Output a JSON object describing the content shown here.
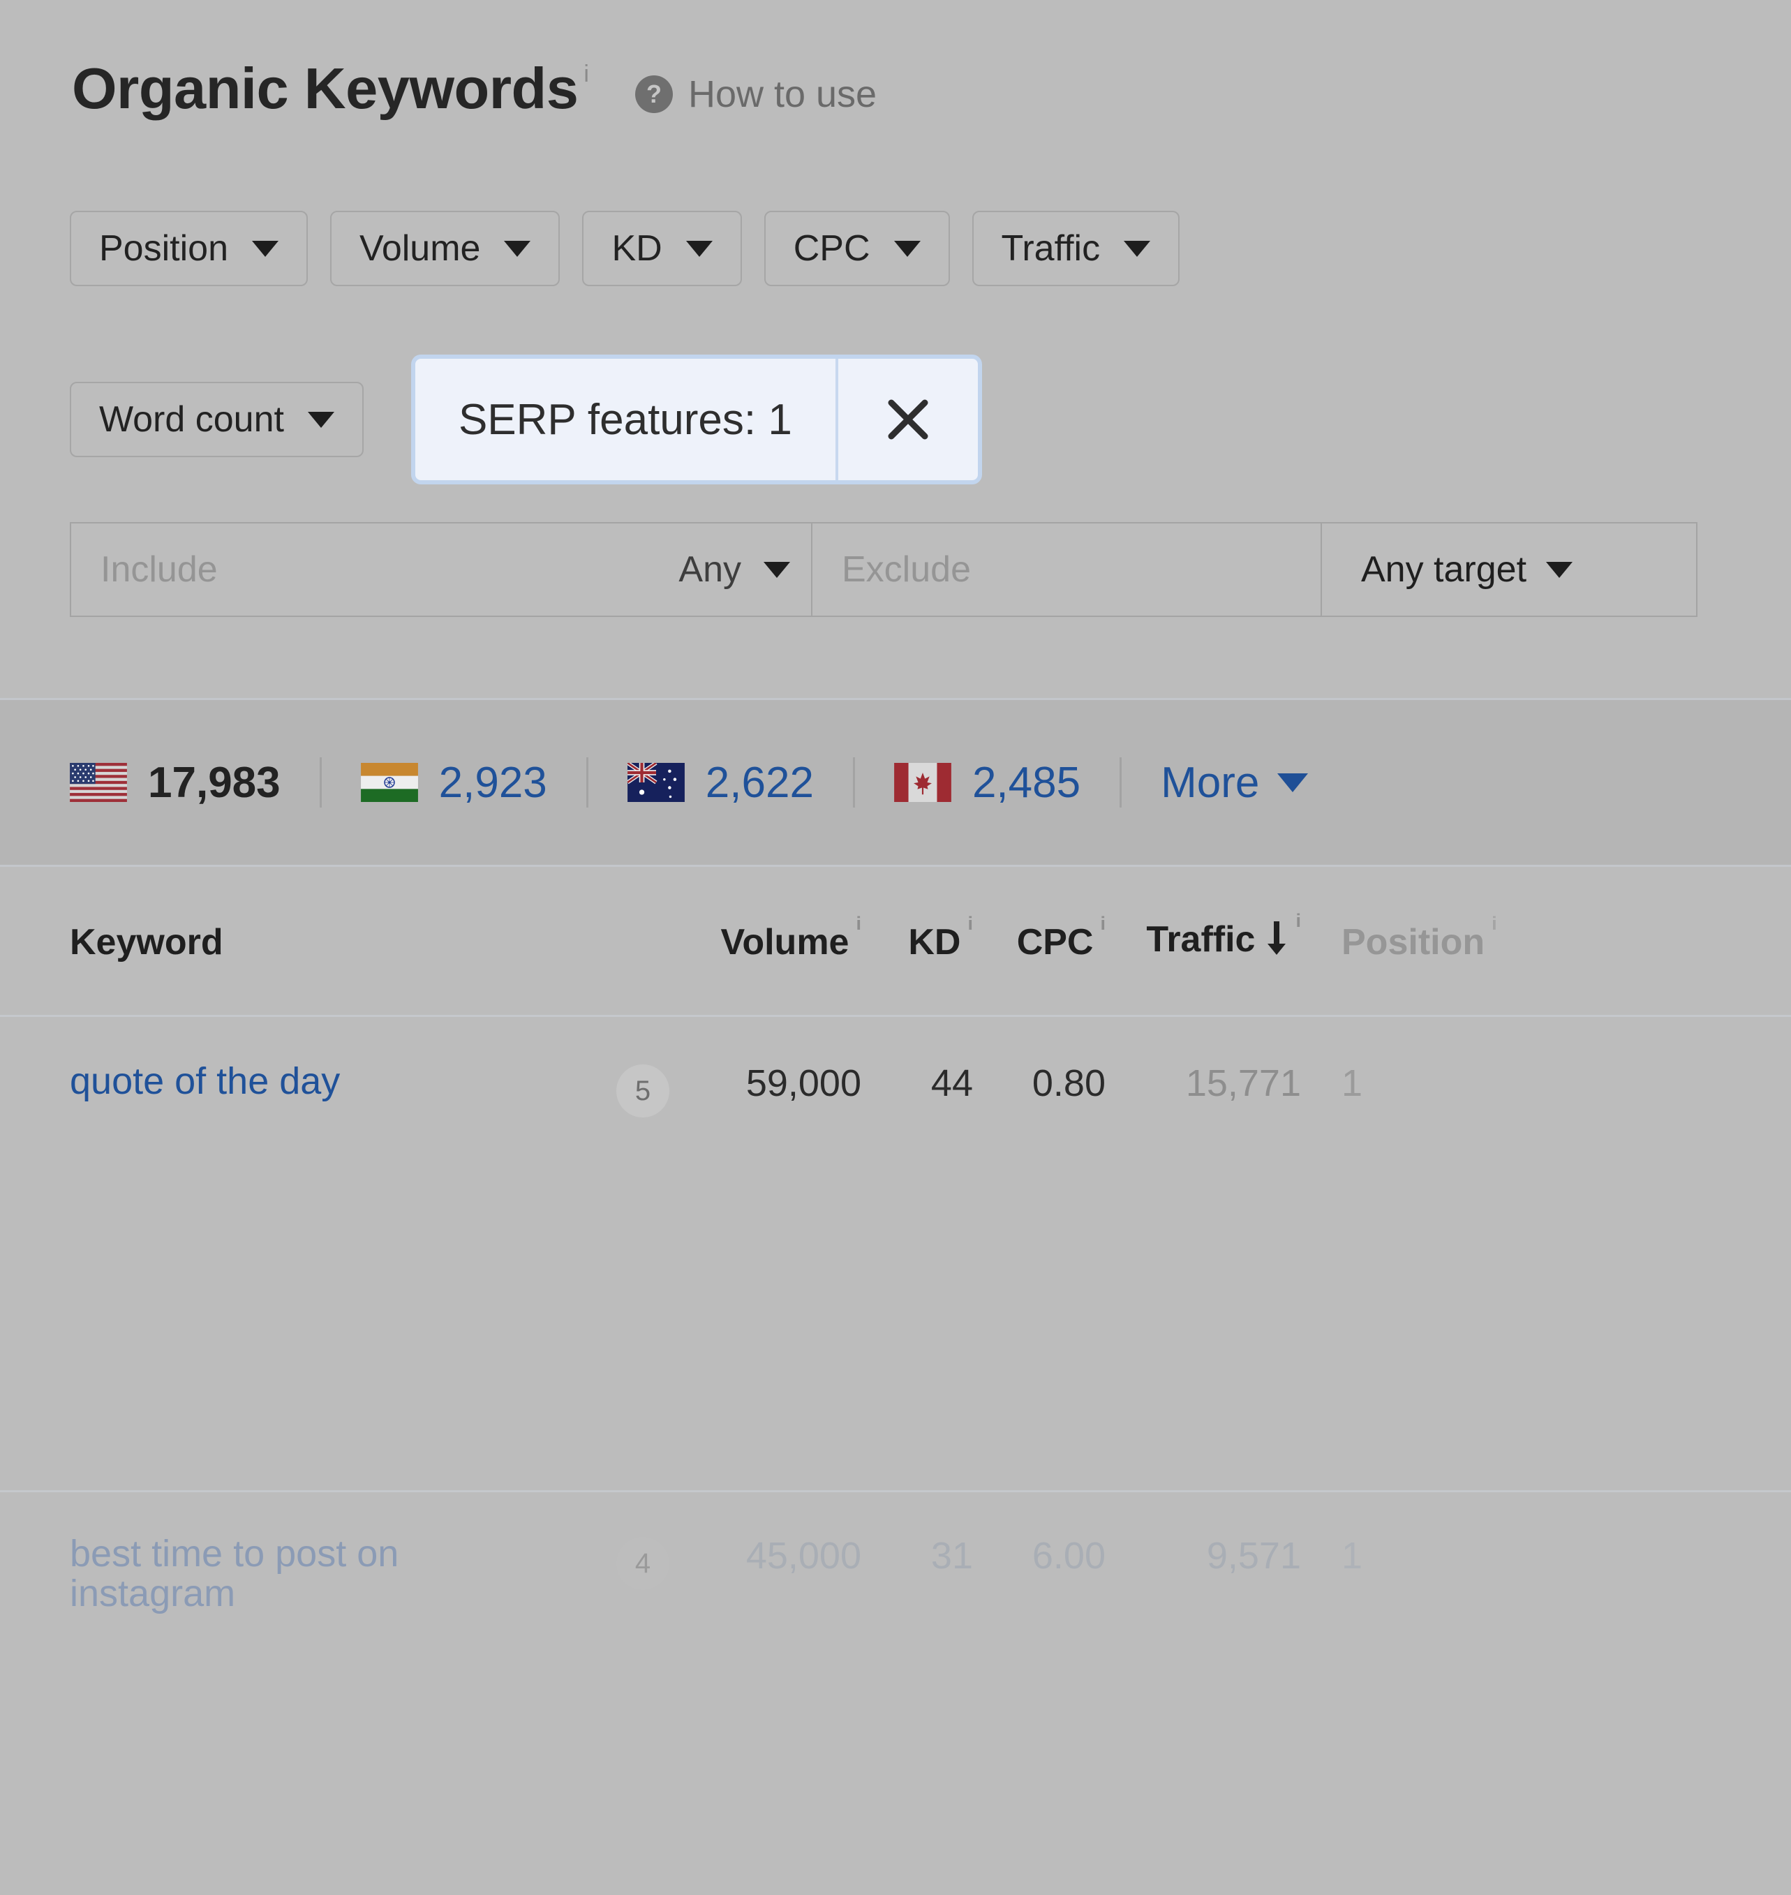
{
  "header": {
    "title": "Organic Keywords",
    "title_info_icon": "info-icon",
    "how_to_use": "How to use",
    "help_icon": "?"
  },
  "filters": {
    "row1": [
      {
        "label": "Position",
        "icon": "chevron-down-icon"
      },
      {
        "label": "Volume",
        "icon": "chevron-down-icon"
      },
      {
        "label": "KD",
        "icon": "chevron-down-icon"
      },
      {
        "label": "CPC",
        "icon": "chevron-down-icon"
      },
      {
        "label": "Traffic",
        "icon": "chevron-down-icon"
      }
    ],
    "row2": [
      {
        "label": "Word count",
        "icon": "chevron-down-icon"
      }
    ],
    "active_chip": {
      "label": "SERP features: 1",
      "close_icon": "close-icon",
      "fill": "#eef2fa",
      "border": "#c2d5ee"
    },
    "include_placeholder": "Include",
    "include_mode": "Any",
    "exclude_placeholder": "Exclude",
    "target_label": "Any target"
  },
  "countries": {
    "items": [
      {
        "flag": "us-flag",
        "count": "17,983",
        "active": true
      },
      {
        "flag": "in-flag",
        "count": "2,923",
        "active": false
      },
      {
        "flag": "au-flag",
        "count": "2,622",
        "active": false
      },
      {
        "flag": "ca-flag",
        "count": "2,485",
        "active": false
      }
    ],
    "more_label": "More",
    "more_icon": "chevron-down-icon"
  },
  "table": {
    "columns": {
      "keyword": "Keyword",
      "volume": "Volume",
      "kd": "KD",
      "cpc": "CPC",
      "traffic": "Traffic",
      "position": "Position"
    },
    "sort": {
      "column": "Traffic",
      "direction": "desc",
      "icon": "arrow-down-icon"
    },
    "rows": [
      {
        "keyword": "quote of the day",
        "badge": "5",
        "volume": "59,000",
        "kd": "44",
        "cpc": "0.80",
        "traffic": "15,771",
        "position": "1"
      },
      {
        "keyword": "best time to post on instagram",
        "badge": "4",
        "volume": "45,000",
        "kd": "31",
        "cpc": "6.00",
        "traffic": "9,571",
        "position": "1"
      }
    ]
  },
  "theme": {
    "page_bg": "#bcbcbc",
    "band_bg": "#b5b5b5",
    "link_blue": "#1f5199",
    "chip_fill": "#eef2fa",
    "chip_border": "#c2d5ee"
  }
}
